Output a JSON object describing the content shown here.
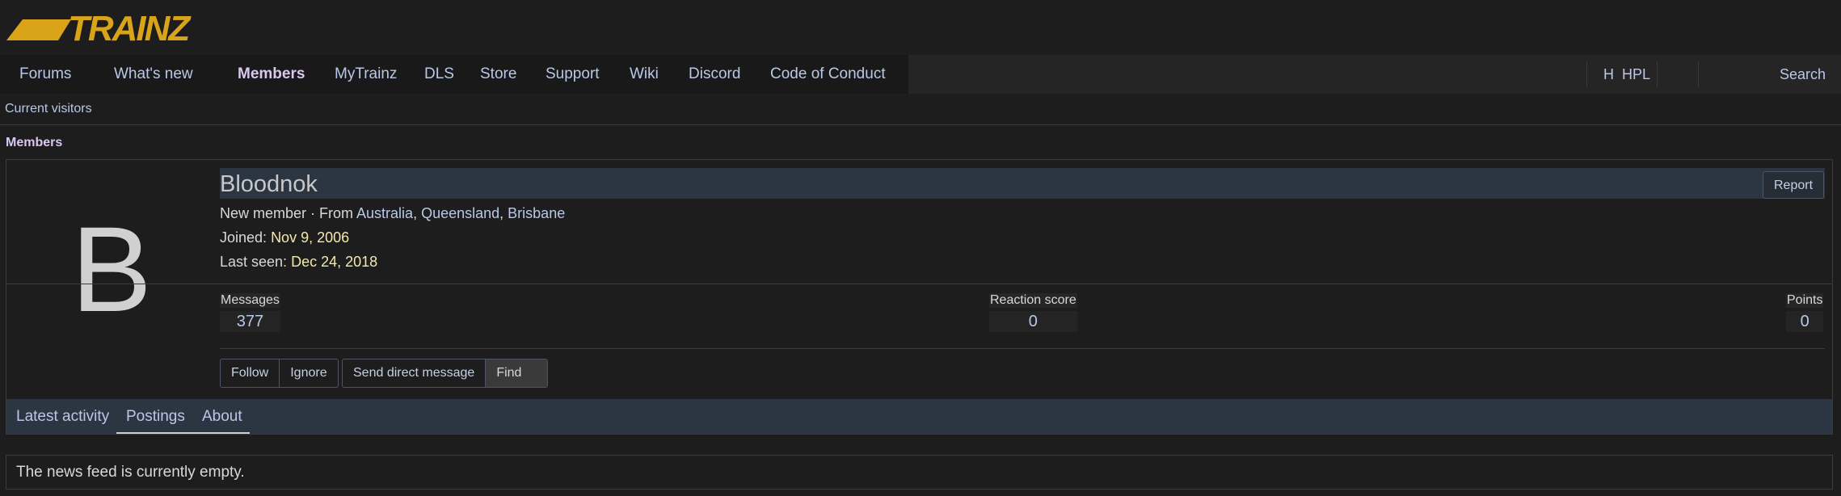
{
  "brand": {
    "logo_text": "TRAINZ",
    "logo_color": "#d9a41a"
  },
  "nav": {
    "items": [
      {
        "label": "Forums",
        "active": false
      },
      {
        "label": "What's new",
        "active": false
      },
      {
        "label": "Members",
        "active": true
      },
      {
        "label": "MyTrainz",
        "active": false
      },
      {
        "label": "DLS",
        "active": false
      },
      {
        "label": "Store",
        "active": false
      },
      {
        "label": "Support",
        "active": false
      },
      {
        "label": "Wiki",
        "active": false
      },
      {
        "label": "Discord",
        "active": false
      },
      {
        "label": "Code of Conduct",
        "active": false
      }
    ],
    "right": {
      "user_initial": "H",
      "username": "HPL",
      "search_label": "Search"
    }
  },
  "subnav": {
    "current_visitors": "Current visitors"
  },
  "breadcrumb": {
    "members": "Members"
  },
  "profile": {
    "avatar_letter": "B",
    "username": "Bloodnok",
    "report_label": "Report",
    "title": "New member",
    "from_prefix": " · From ",
    "location": [
      "Australia",
      "Queensland",
      "Brisbane"
    ],
    "joined_label": "Joined:",
    "joined_date": "Nov 9, 2006",
    "last_seen_label": "Last seen:",
    "last_seen_date": "Dec 24, 2018",
    "stats": {
      "messages_label": "Messages",
      "messages_value": "377",
      "reaction_label": "Reaction score",
      "reaction_value": "0",
      "points_label": "Points",
      "points_value": "0"
    },
    "buttons": {
      "follow": "Follow",
      "ignore": "Ignore",
      "send_message": "Send direct message",
      "find": "Find"
    },
    "tabs": [
      "Latest activity",
      "Postings",
      "About"
    ],
    "active_tab": "Postings"
  },
  "feed": {
    "empty_text": "The news feed is currently empty."
  }
}
